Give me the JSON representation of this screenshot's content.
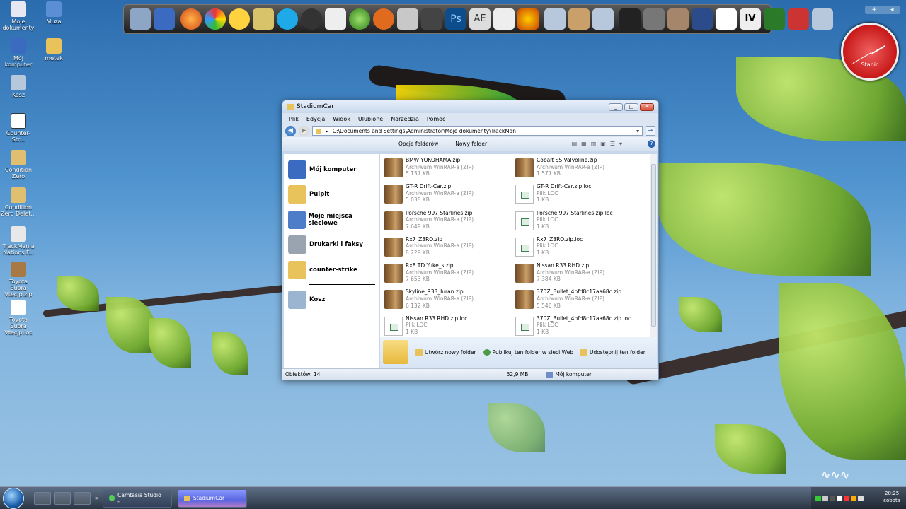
{
  "desktop_icons": [
    {
      "label": "Moje dokumenty",
      "icon": "documents-icon"
    },
    {
      "label": "Muza",
      "icon": "music-icon"
    },
    {
      "label": "Mój komputer",
      "icon": "computer-icon"
    },
    {
      "label": "metek",
      "icon": "folder-icon"
    },
    {
      "label": "Kosz",
      "icon": "recycle-bin-icon"
    },
    {
      "label": "Counter-Str...",
      "icon": "counter-strike-icon"
    },
    {
      "label": "Condition Zero",
      "icon": "counter-strike-icon"
    },
    {
      "label": "Condition Zero Delet...",
      "icon": "counter-strike-icon"
    },
    {
      "label": "TrackMania Nations F...",
      "icon": "trackmania-icon"
    },
    {
      "label": "Toyota Supra Vtecjp.zip",
      "icon": "zip-icon"
    },
    {
      "label": "Toyota Supra Vtecjp.loc",
      "icon": "loc-file-icon"
    }
  ],
  "clock_widget": {
    "label": "Stanic"
  },
  "window": {
    "title": "StadiumCar",
    "menu": [
      "Plik",
      "Edycja",
      "Widok",
      "Ulubione",
      "Narzędzia",
      "Pomoc"
    ],
    "address": "C:\\Documents and Settings\\Administrator\\Moje dokumenty\\TrackMan",
    "commands": {
      "folder_options": "Opcje folderów",
      "new_folder": "Nowy folder"
    },
    "sidebar": [
      {
        "label": "Mój komputer",
        "icon": "computer-icon",
        "color": "#3a6bc0"
      },
      {
        "label": "Pulpit",
        "icon": "folder-icon",
        "color": "#e8c25a"
      },
      {
        "label": "Moje miejsca sieciowe",
        "icon": "network-icon",
        "color": "#4d7cc9"
      },
      {
        "label": "Drukarki i faksy",
        "icon": "printer-icon",
        "color": "#9aa4b0"
      },
      {
        "label": "counter-strike",
        "icon": "folder-icon",
        "color": "#e8c25a"
      },
      {
        "label": "Kosz",
        "icon": "recycle-bin-icon",
        "color": "#9bb4cf"
      }
    ],
    "files": [
      {
        "name": "BMW YOKOHAMA.zip",
        "type": "Archiwum WinRAR-a (ZIP)",
        "size": "5 137 KB",
        "kind": "zip"
      },
      {
        "name": "Cobalt SS Valvoline.zip",
        "type": "Archiwum WinRAR-a (ZIP)",
        "size": "1 577 KB",
        "kind": "zip"
      },
      {
        "name": "GT-R Drift-Car.zip",
        "type": "Archiwum WinRAR-a (ZIP)",
        "size": "5 038 KB",
        "kind": "zip"
      },
      {
        "name": "GT-R Drift-Car.zip.loc",
        "type": "Plik LOC",
        "size": "1 KB",
        "kind": "loc"
      },
      {
        "name": "Porsche 997 Starlines.zip",
        "type": "Archiwum WinRAR-a (ZIP)",
        "size": "7 649 KB",
        "kind": "zip"
      },
      {
        "name": "Porsche 997 Starlines.zip.loc",
        "type": "Plik LOC",
        "size": "1 KB",
        "kind": "loc"
      },
      {
        "name": "Rx7_Z3RO.zip",
        "type": "Archiwum WinRAR-a (ZIP)",
        "size": "8 229 KB",
        "kind": "zip"
      },
      {
        "name": "Rx7_Z3RO.zip.loc",
        "type": "Plik LOC",
        "size": "1 KB",
        "kind": "loc"
      },
      {
        "name": "Rx8 TD Yuke_s.zip",
        "type": "Archiwum WinRAR-a (ZIP)",
        "size": "7 653 KB",
        "kind": "zip"
      },
      {
        "name": "Nissan R33 RHD.zip",
        "type": "Archiwum WinRAR-a (ZIP)",
        "size": "7 384 KB",
        "kind": "zip"
      },
      {
        "name": "Skyline_R33_Iuran.zip",
        "type": "Archiwum WinRAR-a (ZIP)",
        "size": "6 132 KB",
        "kind": "zip"
      },
      {
        "name": "370Z_Bullet_4bfd8c17aa68c.zip",
        "type": "Archiwum WinRAR-a (ZIP)",
        "size": "5 546 KB",
        "kind": "zip"
      },
      {
        "name": "Nissan R33 RHD.zip.loc",
        "type": "Plik LOC",
        "size": "1 KB",
        "kind": "loc"
      },
      {
        "name": "370Z_Bullet_4bfd8c17aa68c.zip.loc",
        "type": "Plik LOC",
        "size": "1 KB",
        "kind": "loc"
      }
    ],
    "tasks": [
      "Utwórz nowy folder",
      "Publikuj ten folder w sieci Web",
      "Udostępnij ten folder"
    ],
    "status": {
      "objects": "Obiektów: 14",
      "size": "52,9 MB",
      "location": "Mój komputer"
    }
  },
  "taskbar": {
    "buttons": [
      {
        "label": "Camtasia Studio -...",
        "active": false
      },
      {
        "label": "StadiumCar",
        "active": true
      }
    ],
    "time": "20:25",
    "day": "sobota"
  },
  "colors": {
    "accent": "#2a64b0",
    "active_task": "#5a66e0"
  }
}
